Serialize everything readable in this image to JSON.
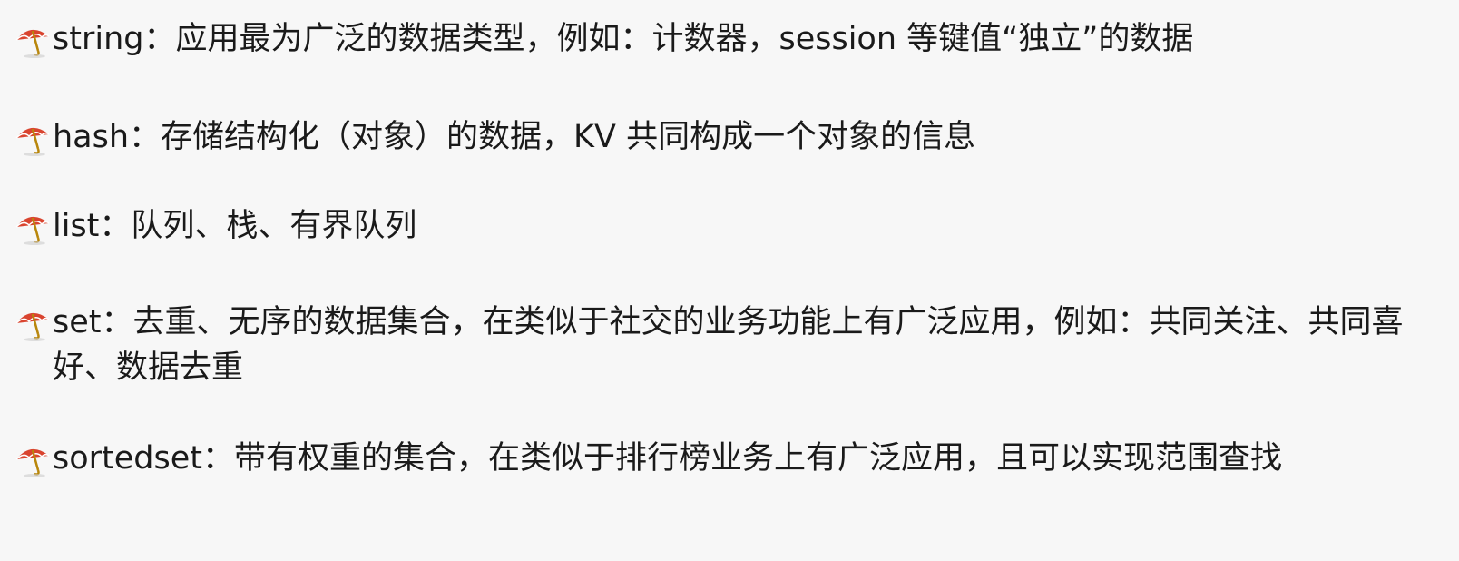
{
  "bullets": [
    {
      "text": "string：应用最为广泛的数据类型，例如：计数器，session 等键值“独立”的数据"
    },
    {
      "text": "hash：存储结构化（对象）的数据，KV 共同构成一个对象的信息"
    },
    {
      "text": "list：队列、栈、有界队列"
    },
    {
      "text": "set：去重、无序的数据集合，在类似于社交的业务功能上有广泛应用，例如：共同关注、共同喜好、数据去重"
    },
    {
      "text": "sortedset：带有权重的集合，在类似于排行榜业务上有广泛应用，且可以实现范围查找"
    }
  ],
  "bullet_icon": "umbrella-icon",
  "colors": {
    "umbrella_red": "#d9442f",
    "umbrella_handle": "#b8860b",
    "background": "#f7f7f7",
    "text": "#1a1a1a"
  }
}
